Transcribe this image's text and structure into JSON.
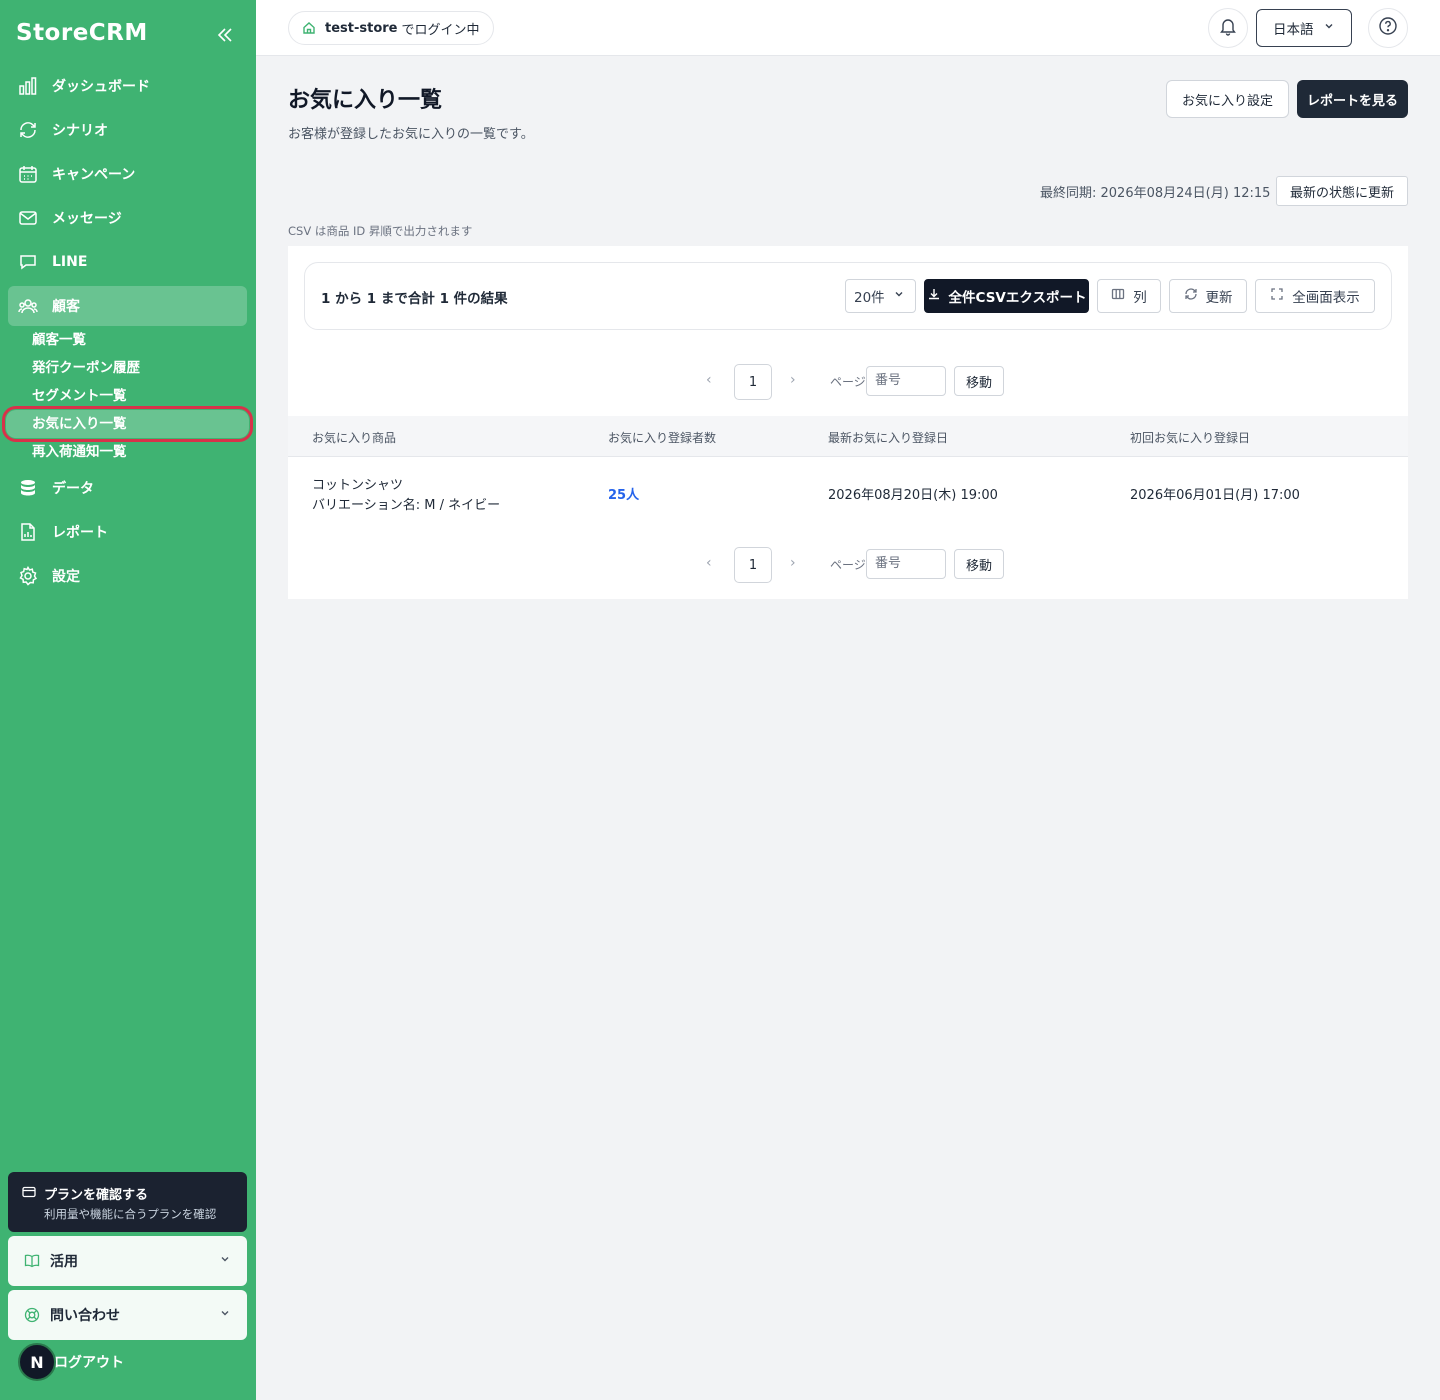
{
  "sidebar": {
    "logo": "StoreCRM",
    "nav": [
      {
        "label": "ダッシュボード",
        "icon": "bar-chart-icon"
      },
      {
        "label": "シナリオ",
        "icon": "refresh-icon"
      },
      {
        "label": "キャンペーン",
        "icon": "calendar-icon"
      },
      {
        "label": "メッセージ",
        "icon": "mail-icon"
      },
      {
        "label": "LINE",
        "icon": "chat-icon"
      },
      {
        "label": "顧客",
        "icon": "users-icon"
      }
    ],
    "customer_sub": [
      {
        "label": "顧客一覧"
      },
      {
        "label": "発行クーポン履歴"
      },
      {
        "label": "セグメント一覧"
      },
      {
        "label": "お気に入り一覧"
      },
      {
        "label": "再入荷通知一覧"
      }
    ],
    "nav2": [
      {
        "label": "データ",
        "icon": "database-icon"
      },
      {
        "label": "レポート",
        "icon": "report-icon"
      },
      {
        "label": "設定",
        "icon": "gear-icon"
      }
    ],
    "plan": {
      "title": "プランを確認する",
      "sub": "利用量や機能に合うプランを確認"
    },
    "usage": "活用",
    "contact": "問い合わせ",
    "logout": "ログアウト",
    "avatar": "N"
  },
  "topbar": {
    "store": "test-store",
    "login_suffix": "でログイン中",
    "language": "日本語"
  },
  "page": {
    "title": "お気に入り一覧",
    "subtitle": "お客様が登録したお気に入りの一覧です。",
    "settings_button": "お気に入り設定",
    "report_button": "レポートを見る",
    "last_sync": "最終同期: 2026年08月24日(月) 12:15",
    "refresh_latest": "最新の状態に更新",
    "csv_note": "CSV は商品 ID 昇順で出力されます"
  },
  "toolbar": {
    "results": "1 から 1 まで合計 1 件の結果",
    "page_size": "20件",
    "export": "全件CSVエクスポート",
    "columns": "列",
    "refresh": "更新",
    "fullscreen": "全画面表示"
  },
  "pager": {
    "current": "1",
    "label": "ページ",
    "placeholder": "番号",
    "go": "移動"
  },
  "table": {
    "headers": [
      "お気に入り商品",
      "お気に入り登録者数",
      "最新お気に入り登録日",
      "初回お気に入り登録日"
    ],
    "rows": [
      {
        "product": "コットンシャツ",
        "variation": "バリエーション名: M / ネイビー",
        "count": "25人",
        "latest": "2026年08月20日(木) 19:00",
        "first": "2026年06月01日(月) 17:00"
      }
    ]
  },
  "colors": {
    "sidebar": "#3fb372",
    "dark": "#1f2937",
    "link": "#2563eb",
    "highlight": "#d8324a"
  }
}
